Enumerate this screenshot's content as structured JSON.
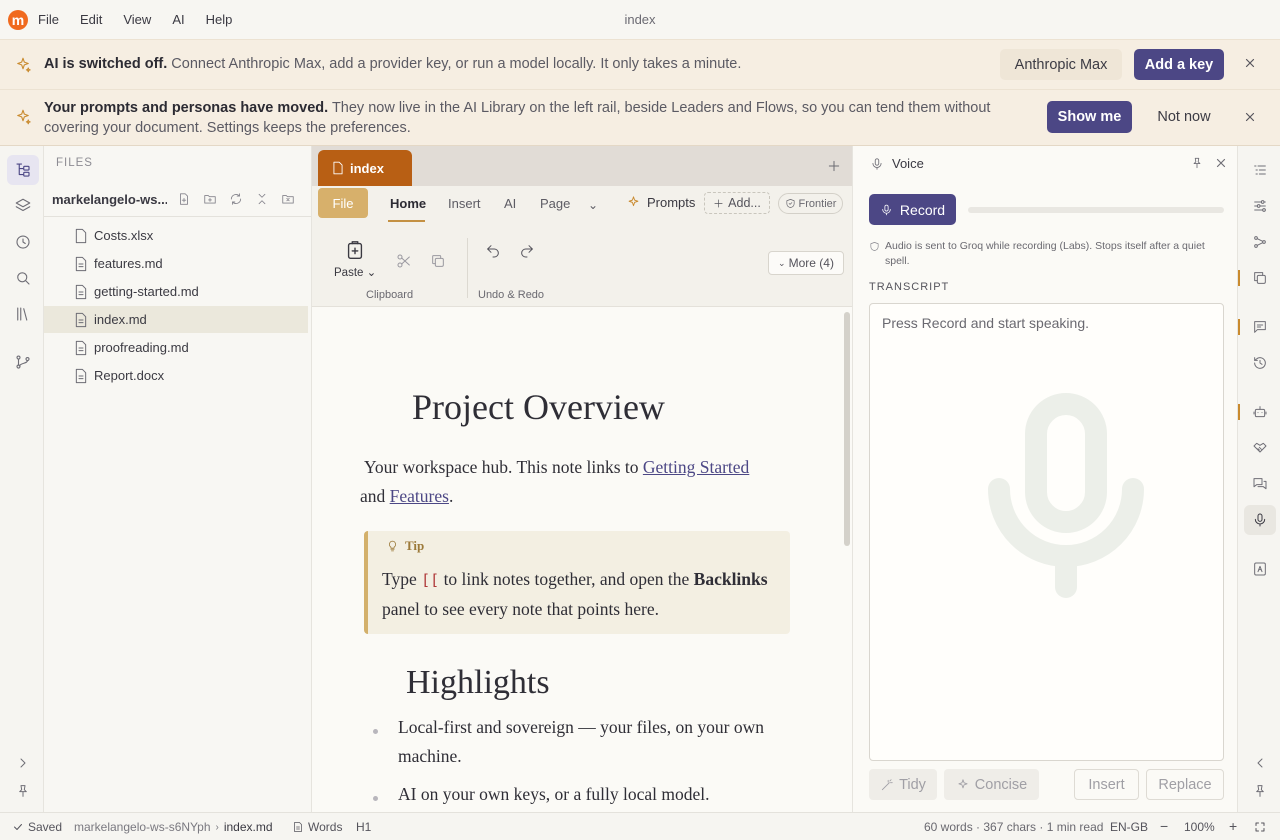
{
  "app": {
    "logo_letter": "m",
    "window_title": "index"
  },
  "menu": [
    "File",
    "Edit",
    "View",
    "AI",
    "Help"
  ],
  "banner_ai": {
    "bold": "AI is switched off.",
    "text": " Connect Anthropic Max, add a provider key, or run a model locally. It only takes a minute.",
    "secondary_button": "Anthropic Max",
    "primary_button": "Add a key"
  },
  "banner_prompts": {
    "bold": "Your prompts and personas have moved.",
    "text": " They now live in the AI Library on the left rail, beside Leaders and Flows, so you can tend them without covering your document. Settings keeps the preferences.",
    "primary_button": "Show me",
    "secondary_button": "Not now"
  },
  "files": {
    "heading": "FILES",
    "workspace": "markelangelo-ws...",
    "items": [
      "Costs.xlsx",
      "features.md",
      "getting-started.md",
      "index.md",
      "proofreading.md",
      "Report.docx"
    ],
    "active_index": 3
  },
  "editor": {
    "tab_label": "index",
    "ribbon": {
      "file": "File",
      "tabs": [
        "Home",
        "Insert",
        "AI",
        "Page"
      ],
      "chevron": "⌄",
      "prompts": "Prompts",
      "add": "Add...",
      "frontier": "Frontier",
      "paste": "Paste",
      "clipboard_group": "Clipboard",
      "undo_group": "Undo & Redo",
      "more": "More (4)"
    },
    "doc": {
      "title": "Project Overview",
      "intro_before": "Your workspace hub. This note links to ",
      "link1": "Getting Started",
      "intro_mid": " and ",
      "link2": "Features",
      "intro_end": ".",
      "tip_label": "Tip",
      "tip_before": "Type ",
      "tip_code": "[[",
      "tip_mid": " to link notes together, and open the ",
      "tip_bold": "Backlinks",
      "tip_after": " panel to see every note that points here.",
      "h2": "Highlights",
      "bullets": [
        "Local-first and sovereign — your files, on your own machine.",
        "AI on your own keys, or a fully local model."
      ]
    }
  },
  "voice": {
    "title": "Voice",
    "record": "Record",
    "note": "Audio is sent to Groq while recording (Labs). Stops itself after a quiet spell.",
    "transcript_label": "TRANSCRIPT",
    "placeholder": "Press Record and start speaking.",
    "tidy": "Tidy",
    "concise": "Concise",
    "insert": "Insert",
    "replace": "Replace"
  },
  "status": {
    "saved": "Saved",
    "workspace": "markelangelo-ws-s6NYph",
    "sep": "›",
    "file": "index.md",
    "words_label": "Words",
    "heading": "H1",
    "counts": "60 words · 367 chars · 1 min read",
    "lang": "EN-GB",
    "minus": "−",
    "zoom": "100%",
    "plus": "+"
  },
  "colors": {
    "accent": "#4c4785",
    "brand": "#f06a1f",
    "tab": "#b85f14",
    "banner": "#f6eee2"
  }
}
